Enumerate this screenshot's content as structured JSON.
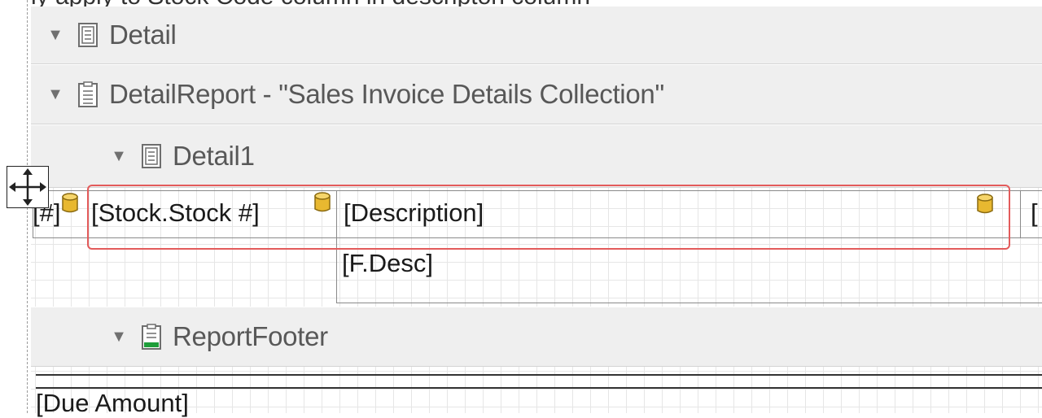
{
  "top_text": "ly apply to Stock Code column in descripton column",
  "bands": {
    "detail": {
      "title": "Detail",
      "arrow": "▼"
    },
    "detail_report": {
      "title": "DetailReport - \"Sales Invoice Details Collection\"",
      "arrow": "▼"
    },
    "detail1": {
      "title": "Detail1",
      "arrow": "▼"
    },
    "report_footer": {
      "title": "ReportFooter",
      "arrow": "▼"
    }
  },
  "cells": {
    "hash": "[#]",
    "stock": "[Stock.Stock #]",
    "description": "[Description]",
    "next": "[",
    "f_desc": "[F.Desc]",
    "due_amount": "[Due Amount]"
  },
  "colors": {
    "selection": "#e35b5b",
    "band_bg": "#efefef",
    "db_icon": "#e8b830",
    "footer_icon_green": "#1e9e3a"
  },
  "icons": {
    "band_collapse": "triangle-down",
    "detail_band": "band-detail-icon",
    "detail_report_band": "band-detail-report-icon",
    "report_footer_band": "band-report-footer-icon",
    "bound_field": "database-icon",
    "move": "move-icon"
  }
}
